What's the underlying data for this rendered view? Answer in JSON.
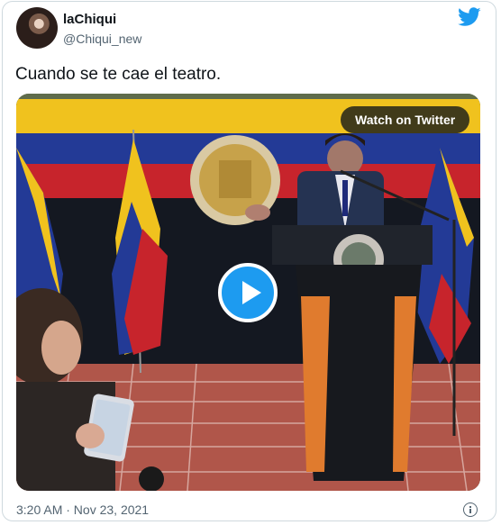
{
  "author": {
    "name": "laChiqui",
    "handle": "@Chiqui_new"
  },
  "tweet": {
    "text": "Cuando se te cae el teatro."
  },
  "media": {
    "watch_label": "Watch on Twitter",
    "play_icon": "play-icon"
  },
  "meta": {
    "timestamp": "3:20 AM · Nov 23, 2021"
  },
  "icons": {
    "brand": "twitter-bird-icon",
    "info": "info-icon"
  },
  "colors": {
    "twitter_blue": "#1d9bf0",
    "secondary_text": "#536471",
    "border": "#cfd9de"
  }
}
